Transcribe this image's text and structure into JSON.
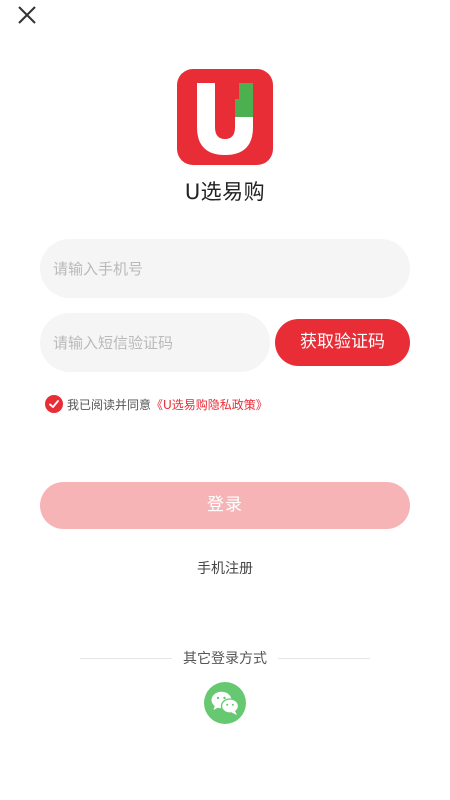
{
  "header": {
    "close_icon": "close-icon"
  },
  "brand": {
    "logo_letter": "U",
    "app_name": "U选易购",
    "colors": {
      "primary": "#e92d37",
      "logo_green": "#4caf50"
    }
  },
  "form": {
    "phone_placeholder": "请输入手机号",
    "code_placeholder": "请输入短信验证码",
    "get_code_label": "获取验证码"
  },
  "agreement": {
    "checked": true,
    "prefix_text": "我已阅读并同意",
    "policy_text": "《U选易购隐私政策》"
  },
  "actions": {
    "login_label": "登录",
    "register_label": "手机注册"
  },
  "other_login": {
    "label": "其它登录方式",
    "wechat_icon": "wechat-icon",
    "wechat_color": "#67c872"
  }
}
